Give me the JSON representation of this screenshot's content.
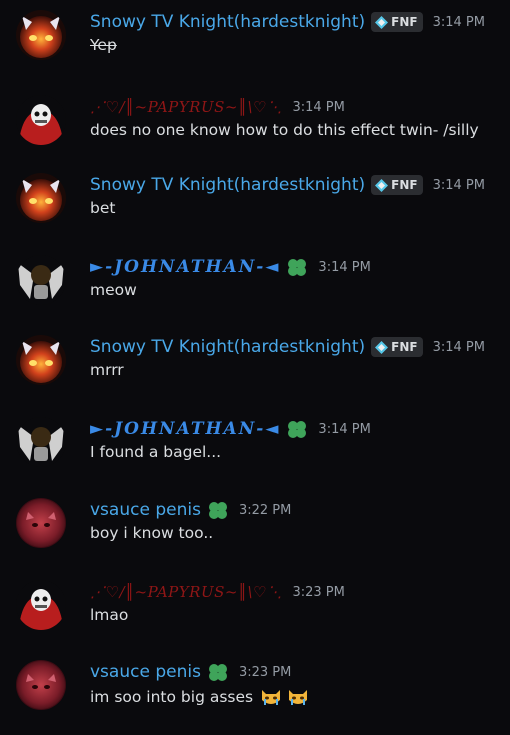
{
  "messages": [
    {
      "author": "Snowy TV Knight(hardestknight)",
      "tag": "FNF",
      "time": "3:14 PM",
      "text": "Yep",
      "strikethrough": true,
      "avatar": "fire-cat-avatar"
    },
    {
      "author": "⋰♡/║~PAPYRUS~║\\♡⋱",
      "time": "3:14 PM",
      "text": "does no one know how to do this effect twin- /silly",
      "avatar": "papyrus-skull-avatar"
    },
    {
      "author": "Snowy TV Knight(hardestknight)",
      "tag": "FNF",
      "time": "3:14 PM",
      "text": "bet",
      "avatar": "fire-cat-avatar"
    },
    {
      "author": "►-JOHNATHAN-◄",
      "time": "3:14 PM",
      "text": "meow",
      "avatar": "winged-figure-avatar"
    },
    {
      "author": "Snowy TV Knight(hardestknight)",
      "tag": "FNF",
      "time": "3:14 PM",
      "text": "mrrr",
      "avatar": "fire-cat-avatar"
    },
    {
      "author": "►-JOHNATHAN-◄",
      "time": "3:14 PM",
      "text": "I found a bagel...",
      "avatar": "winged-figure-avatar"
    },
    {
      "author": "vsauce penis",
      "time": "3:22 PM",
      "text": "boy i know too..",
      "avatar": "red-cat-avatar"
    },
    {
      "author": "⋰♡/║~PAPYRUS~║\\♡⋱",
      "time": "3:23 PM",
      "text": "lmao",
      "avatar": "papyrus-skull-avatar"
    },
    {
      "author": "vsauce penis",
      "time": "3:23 PM",
      "text": "im soo into big asses",
      "emoji": "crying-cat-emoji",
      "avatar": "red-cat-avatar"
    }
  ],
  "colors": {
    "background": "#0a0a0d",
    "name_blue": "#4aa8e8",
    "papyrus_red": "#8e1616",
    "clover_green": "#3fa45a",
    "timestamp": "#949ba4"
  }
}
